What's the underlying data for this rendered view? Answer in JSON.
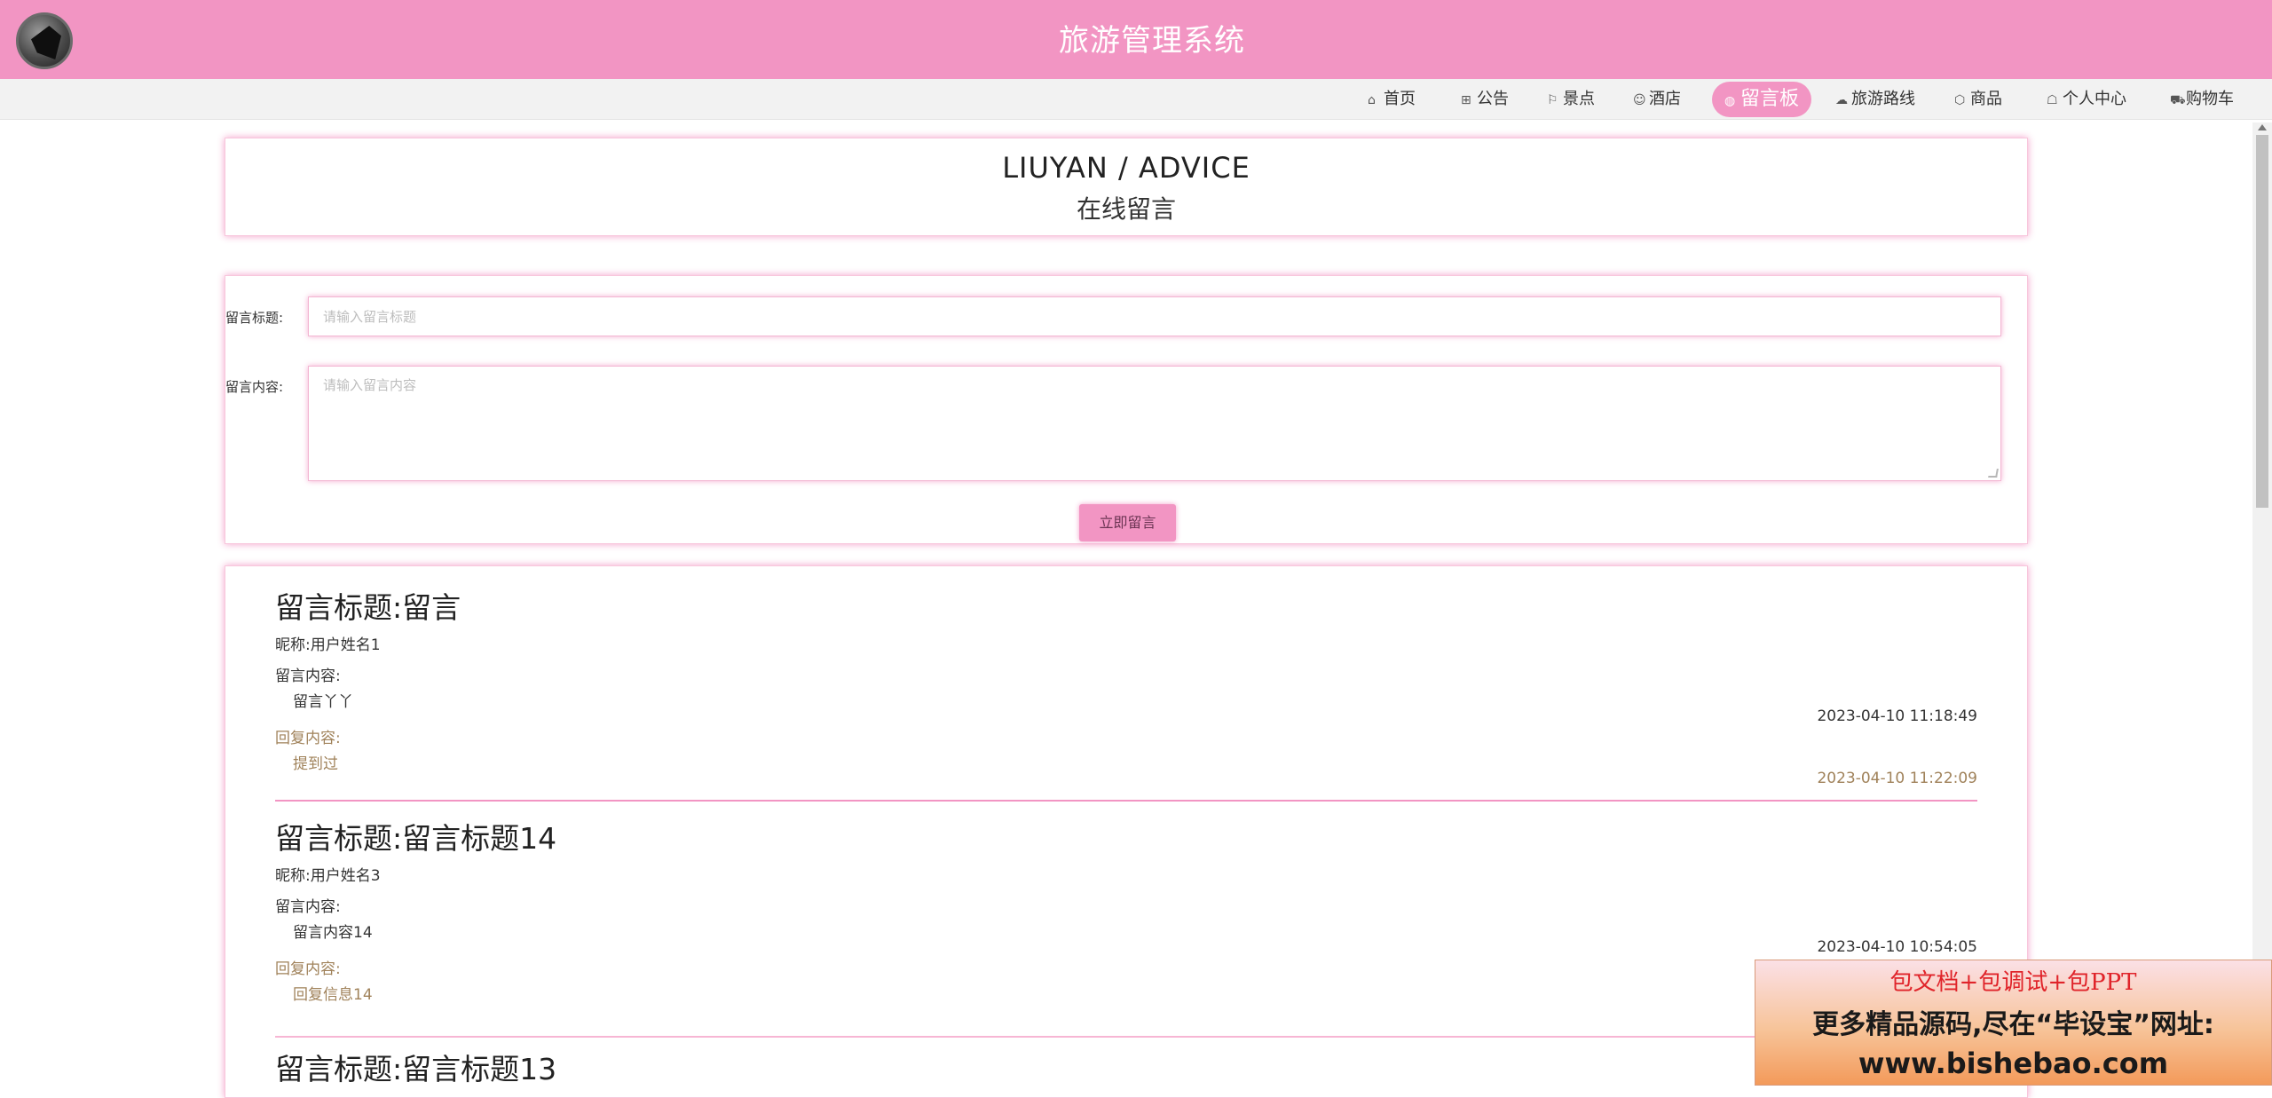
{
  "header": {
    "site_title": "旅游管理系统"
  },
  "nav": {
    "items": [
      {
        "label": "首页",
        "icon": "home-icon"
      },
      {
        "label": "公告",
        "icon": "gift-icon"
      },
      {
        "label": "景点",
        "icon": "flag-icon"
      },
      {
        "label": "酒店",
        "icon": "hotel-icon"
      },
      {
        "label": "留言板",
        "icon": "chat-icon",
        "active": true
      },
      {
        "label": "旅游路线",
        "icon": "cloud-icon"
      },
      {
        "label": "商品",
        "icon": "box-icon"
      },
      {
        "label": "个人中心",
        "icon": "user-icon"
      },
      {
        "label": "购物车",
        "icon": "cart-icon"
      }
    ]
  },
  "page_head": {
    "en": "LIUYAN / ADVICE",
    "cn": "在线留言"
  },
  "form": {
    "title_label": "留言标题:",
    "title_placeholder": "请输入留言标题",
    "content_label": "留言内容:",
    "content_placeholder": "请输入留言内容",
    "submit_label": "立即留言"
  },
  "messages": [
    {
      "title": "留言标题:留言",
      "nickname": "昵称:用户姓名1",
      "content_label": "留言内容:",
      "content": "留言丫丫",
      "time": "2023-04-10 11:18:49",
      "reply_label": "回复内容:",
      "reply": "提到过",
      "reply_time": "2023-04-10 11:22:09"
    },
    {
      "title": "留言标题:留言标题14",
      "nickname": "昵称:用户姓名3",
      "content_label": "留言内容:",
      "content": "留言内容14",
      "time": "2023-04-10 10:54:05",
      "reply_label": "回复内容:",
      "reply": "回复信息14",
      "reply_time": ""
    },
    {
      "title": "留言标题:留言标题13"
    }
  ],
  "ad": {
    "line1": "包文档+包调试+包PPT",
    "line2": "更多精品源码,尽在“毕设宝”网址:",
    "line3": "www.bishebao.com"
  },
  "colors": {
    "primary_pink": "#f295c3",
    "reply_text": "#a0825a"
  }
}
